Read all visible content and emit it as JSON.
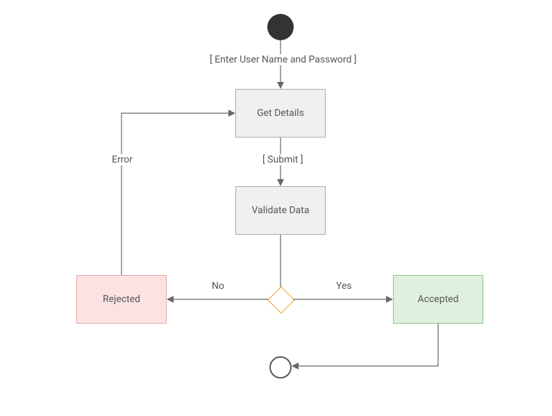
{
  "nodes": {
    "get_details": "Get Details",
    "validate_data": "Validate Data",
    "rejected": "Rejected",
    "accepted": "Accepted"
  },
  "edges": {
    "enter_credentials": "[ Enter User Name and Password ]",
    "submit": "[ Submit ]",
    "no": "No",
    "yes": "Yes",
    "error": "Error"
  }
}
